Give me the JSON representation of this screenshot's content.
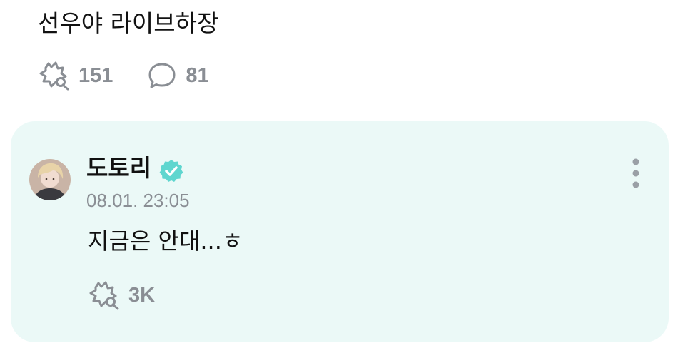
{
  "post": {
    "text": "선우야 라이브하장",
    "likes": "151",
    "comments": "81"
  },
  "comment": {
    "author": "도토리",
    "verified": true,
    "timestamp": "08.01. 23:05",
    "text": "지금은 안대...ㅎ",
    "likes": "3K"
  },
  "icons": {
    "like": "bubble-hand-like-icon",
    "comment": "speech-bubble-icon",
    "verified": "verified-badge-icon",
    "more": "vertical-ellipsis-icon"
  },
  "colors": {
    "card_background": "#ebf9f7",
    "verified_badge": "#5fd6cf",
    "muted_text": "#8a8e94",
    "primary_text": "#111111"
  }
}
